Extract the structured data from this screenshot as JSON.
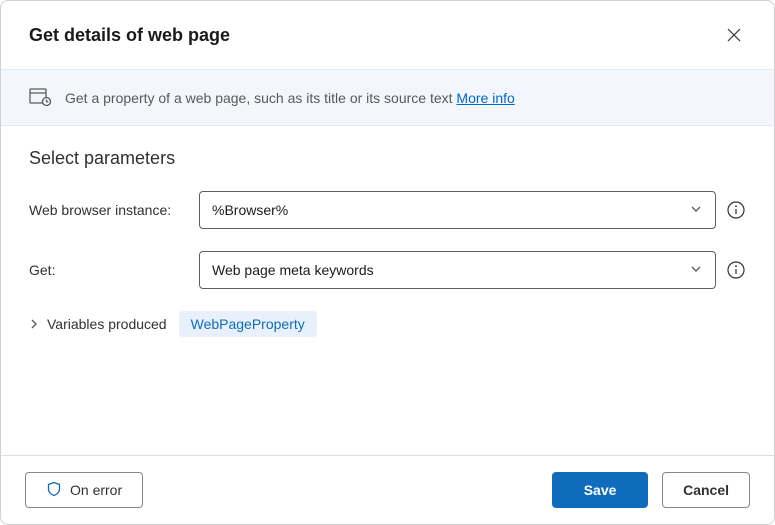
{
  "dialog": {
    "title": "Get details of web page"
  },
  "banner": {
    "text": "Get a property of a web page, such as its title or its source text ",
    "more_info": "More info"
  },
  "params": {
    "section_title": "Select parameters",
    "browser_label": "Web browser instance:",
    "browser_value": "%Browser%",
    "get_label": "Get:",
    "get_value": "Web page meta keywords"
  },
  "vars": {
    "label": "Variables produced",
    "chip": "WebPageProperty"
  },
  "footer": {
    "on_error": "On error",
    "save": "Save",
    "cancel": "Cancel"
  }
}
